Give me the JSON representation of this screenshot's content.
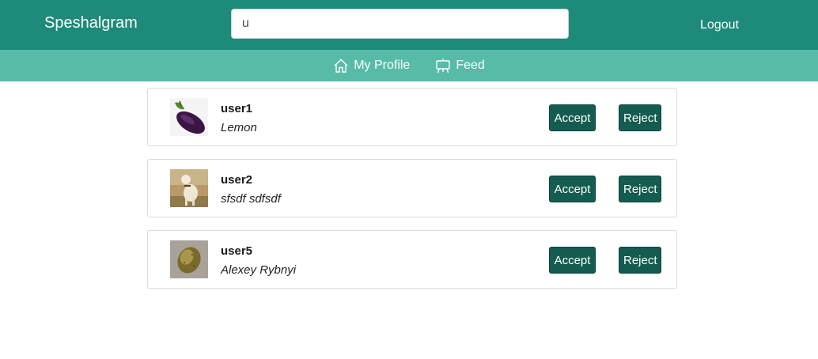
{
  "header": {
    "brand": "Speshalgram",
    "search_value": "u",
    "logout_label": "Logout"
  },
  "subnav": {
    "items": [
      {
        "label": "My Profile",
        "icon": "home-icon"
      },
      {
        "label": "Feed",
        "icon": "easel-icon"
      }
    ]
  },
  "requests": [
    {
      "username": "user1",
      "full_name": "Lemon",
      "avatar": "eggplant",
      "accept_label": "Accept",
      "reject_label": "Reject"
    },
    {
      "username": "user2",
      "full_name": "sfsdf sdfsdf",
      "avatar": "dog",
      "accept_label": "Accept",
      "reject_label": "Reject"
    },
    {
      "username": "user5",
      "full_name": "Alexey Rybnyi",
      "avatar": "potato",
      "accept_label": "Accept",
      "reject_label": "Reject"
    }
  ],
  "colors": {
    "topbar": "#1e8a7a",
    "subnav": "#58bba8",
    "button": "#135c4f"
  }
}
